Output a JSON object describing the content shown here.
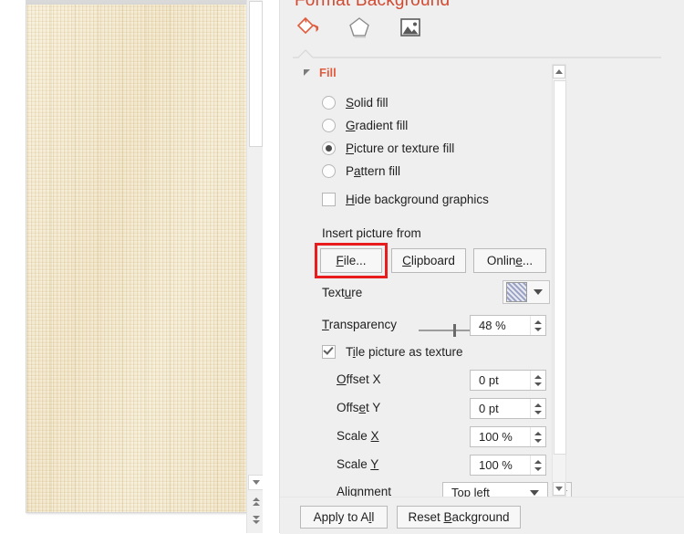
{
  "pane": {
    "title": "Format Background",
    "tabs": [
      {
        "name": "fill-tab",
        "icon": "paint-bucket-icon",
        "active": true
      },
      {
        "name": "effects-tab",
        "icon": "pentagon-icon",
        "active": false
      },
      {
        "name": "picture-tab",
        "icon": "picture-icon",
        "active": false
      }
    ],
    "section": {
      "label": "Fill",
      "expanded": true
    },
    "fill_options": [
      {
        "label_pre": "",
        "accel": "S",
        "label_post": "olid fill",
        "selected": false
      },
      {
        "label_pre": "",
        "accel": "G",
        "label_post": "radient fill",
        "selected": false
      },
      {
        "label_pre": "",
        "accel": "P",
        "label_post": "icture or texture fill",
        "selected": true
      },
      {
        "label_pre": "P",
        "accel": "a",
        "label_post": "ttern fill",
        "selected": false
      }
    ],
    "hide_background_graphics": {
      "label_pre": "",
      "accel": "H",
      "label_post": "ide background graphics",
      "checked": false
    },
    "insert_picture_from": {
      "label": "Insert picture from",
      "buttons": [
        {
          "name": "file-button",
          "pre": "",
          "accel": "F",
          "post": "ile...",
          "highlighted": true
        },
        {
          "name": "clipboard-button",
          "pre": "",
          "accel": "C",
          "post": "lipboard",
          "highlighted": false
        },
        {
          "name": "online-button",
          "pre": "Onlin",
          "accel": "e",
          "post": "...",
          "highlighted": false
        }
      ]
    },
    "texture": {
      "label_pre": "Text",
      "accel": "u",
      "label_post": "re"
    },
    "transparency": {
      "label_pre": "",
      "accel": "T",
      "label_post": "ransparency",
      "value": "48 %",
      "percent": 48
    },
    "tile_picture": {
      "label_pre": "T",
      "accel": "i",
      "label_post": "le picture as texture",
      "checked": true
    },
    "fields": [
      {
        "name": "offset-x-field",
        "label_pre": "",
        "accel": "O",
        "label_post": "ffset X",
        "value": "0 pt"
      },
      {
        "name": "offset-y-field",
        "label_pre": "Offs",
        "accel": "e",
        "label_post": "t Y",
        "value": "0 pt"
      },
      {
        "name": "scale-x-field",
        "label_pre": "Scale ",
        "accel": "X",
        "label_post": "",
        "value": "100 %"
      },
      {
        "name": "scale-y-field",
        "label_pre": "Scale ",
        "accel": "Y",
        "label_post": "",
        "value": "100 %"
      }
    ],
    "alignment": {
      "label_pre": "A",
      "accel": "l",
      "label_post": "ignment",
      "value": "Top left"
    },
    "footer": {
      "apply_pre": "Apply to A",
      "apply_accel": "l",
      "apply_post": "l",
      "reset_pre": "Reset ",
      "reset_accel": "B",
      "reset_post": "ackground"
    }
  },
  "colors": {
    "title": "#d04a32",
    "section_accent": "#e05c3e",
    "highlight": "#e81c1c",
    "pane_bg": "#efefef",
    "slide_texture": "#ead9b0"
  }
}
